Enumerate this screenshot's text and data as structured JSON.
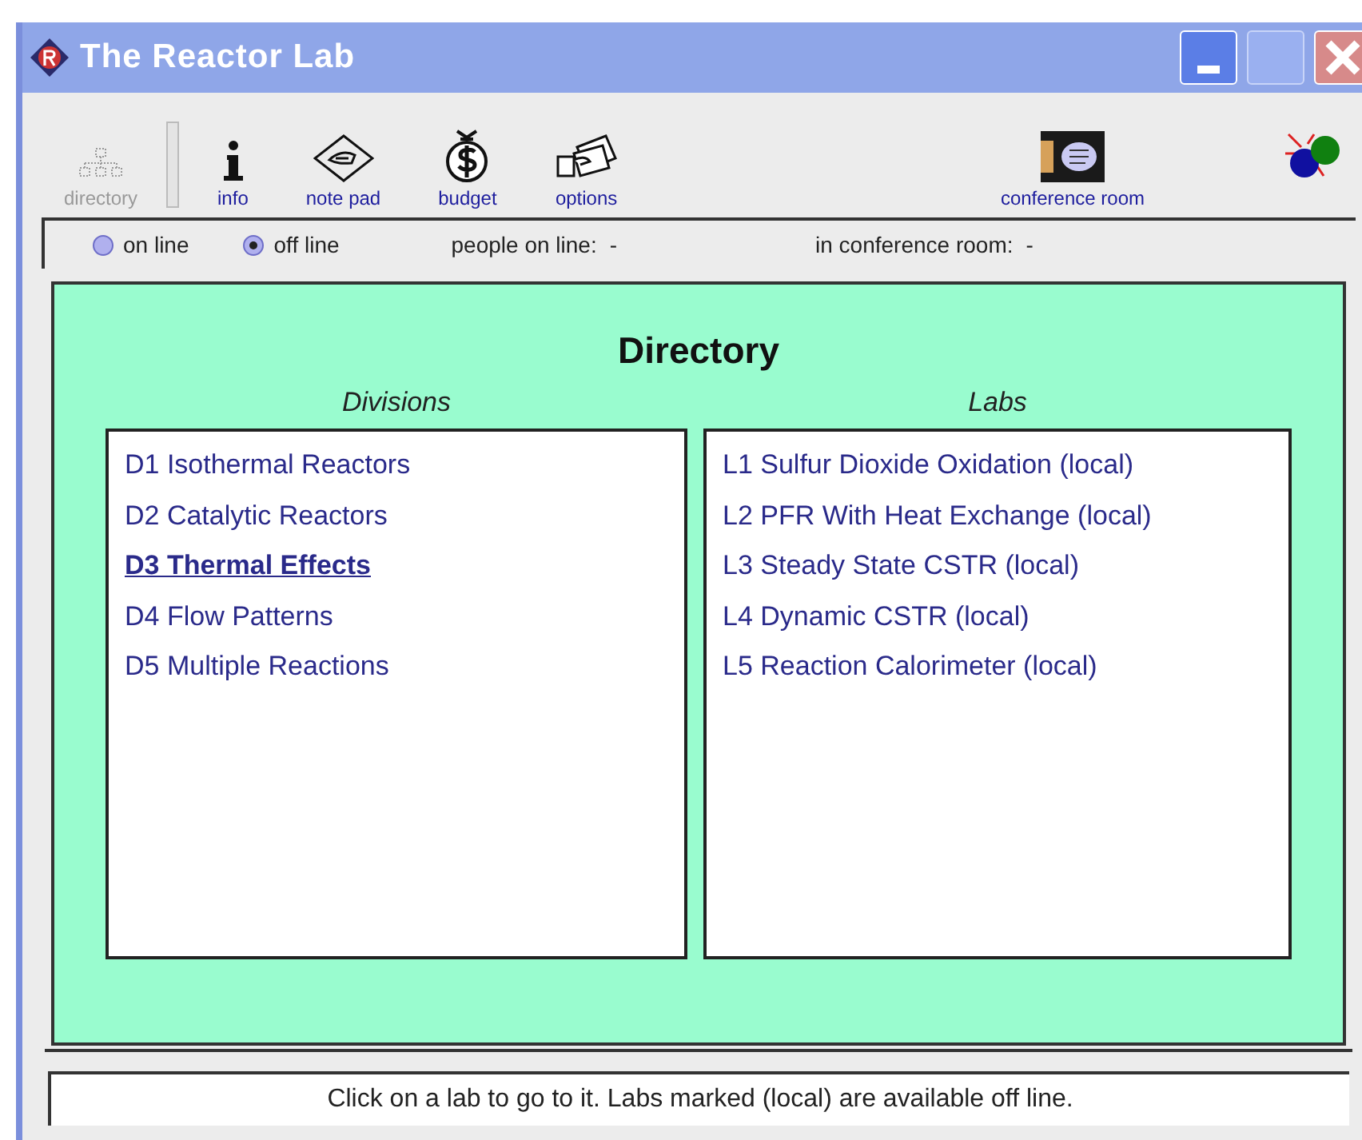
{
  "window": {
    "title": "The Reactor Lab"
  },
  "toolbar": [
    {
      "label": "directory",
      "kind": "directory",
      "disabled": true
    },
    {
      "label": "info",
      "kind": "info",
      "disabled": false
    },
    {
      "label": "note pad",
      "kind": "notepad",
      "disabled": false
    },
    {
      "label": "budget",
      "kind": "budget",
      "disabled": false
    },
    {
      "label": "options",
      "kind": "options",
      "disabled": false
    },
    {
      "label": "conference room",
      "kind": "conference",
      "disabled": false
    }
  ],
  "connection": [
    {
      "label": "on line",
      "selected": false
    },
    {
      "label": "off line",
      "selected": true
    }
  ],
  "people_on_line": {
    "label": "people on line:",
    "value": "-"
  },
  "in_conference_room": {
    "label": "in conference room:",
    "value": "-"
  },
  "directory": {
    "title": "Directory",
    "divisions": {
      "heading": "Divisions",
      "items": [
        {
          "label": "D1 Isothermal Reactors",
          "selected": false
        },
        {
          "label": "D2 Catalytic Reactors",
          "selected": false
        },
        {
          "label": "D3 Thermal Effects",
          "selected": true
        },
        {
          "label": "D4 Flow Patterns",
          "selected": false
        },
        {
          "label": "D5 Multiple Reactions",
          "selected": false
        }
      ]
    },
    "labs": {
      "heading": "Labs",
      "items": [
        "L1 Sulfur Dioxide Oxidation (local)",
        "L2 PFR With Heat Exchange (local)",
        "L3 Steady State CSTR (local)",
        "L4 Dynamic CSTR (local)",
        "L5 Reaction Calorimeter (local)"
      ]
    }
  },
  "status_bar": "Click on a lab to go to it. Labs marked (local) are available off line."
}
